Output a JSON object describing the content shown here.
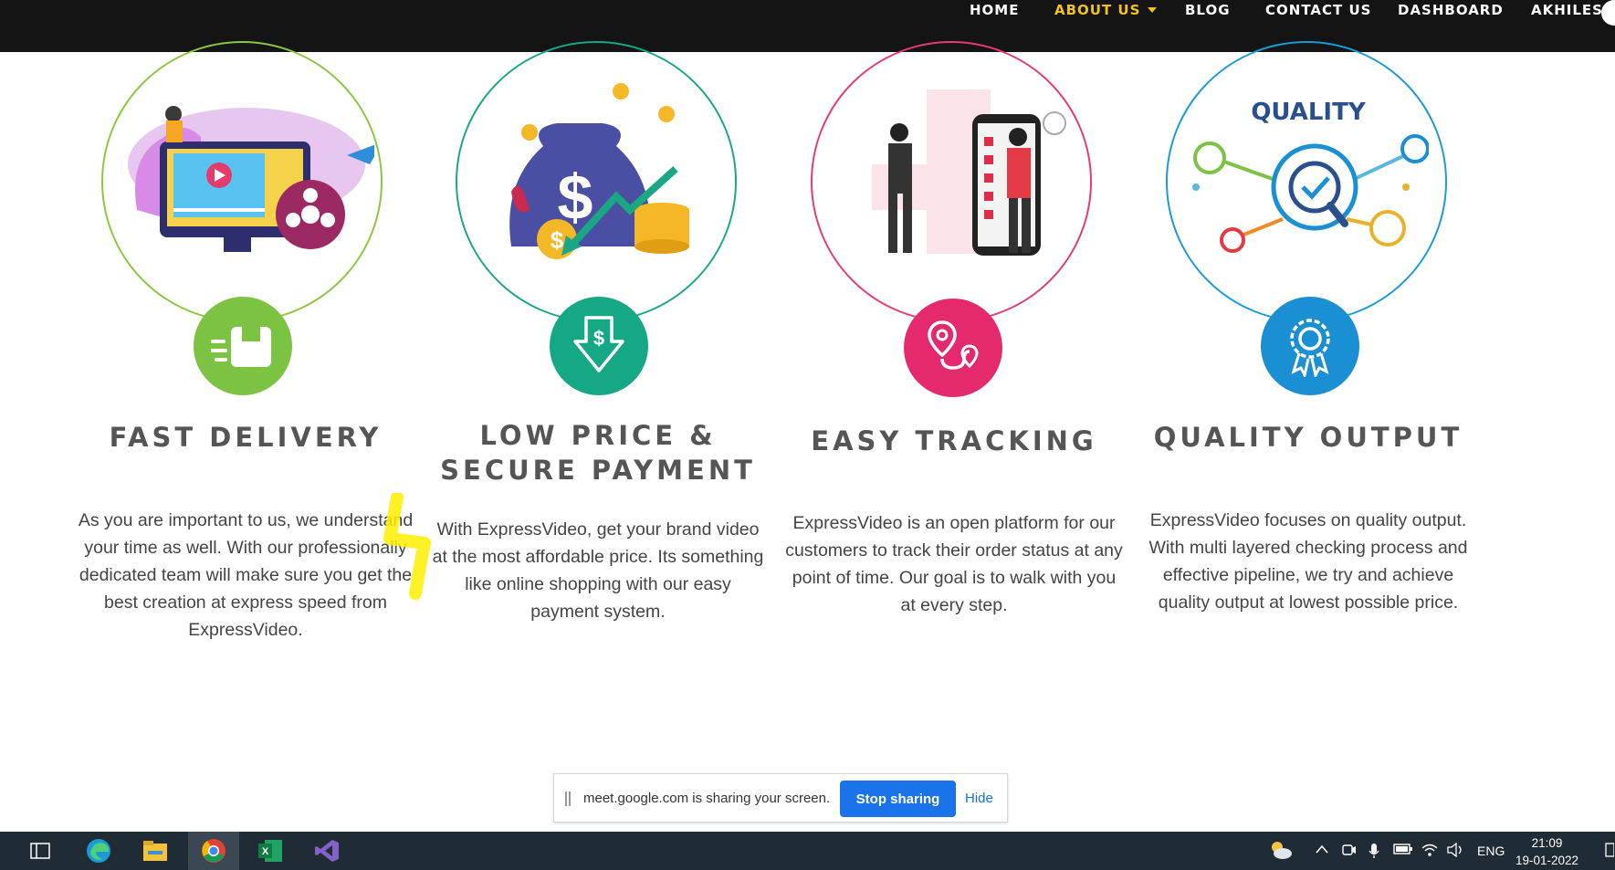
{
  "nav": {
    "items": [
      {
        "label": "HOME"
      },
      {
        "label": "ABOUT US"
      },
      {
        "label": "BLOG"
      },
      {
        "label": "CONTACT US"
      },
      {
        "label": "DASHBOARD"
      },
      {
        "label": "AKHILESH"
      }
    ],
    "active_color": "#f2c318"
  },
  "features": [
    {
      "title": "FAST DELIVERY",
      "description": "As you are important to us, we understand your time as well. With our professionally dedicated team will make sure you get the best creation at express speed from ExpressVideo.",
      "color": "#7cc243",
      "icon": "delivery-box-icon"
    },
    {
      "title": "LOW PRICE & SECURE PAYMENT",
      "description": "With ExpressVideo, get your brand video at the most affordable price. Its something like online shopping with our easy payment system.",
      "color": "#16a884",
      "icon": "price-down-icon"
    },
    {
      "title": "EASY TRACKING",
      "description": "ExpressVideo is an open platform for our customers to track their order status at any point of time. Our goal is to walk with you at every step.",
      "color": "#e42a6d",
      "icon": "route-tracking-icon"
    },
    {
      "title": "QUALITY OUTPUT",
      "description": "ExpressVideo focuses on quality output. With multi layered checking process and effective pipeline, we try and achieve quality output at lowest possible price.",
      "color": "#1a8fd4",
      "icon": "quality-award-icon",
      "illustration_text": "QUALITY"
    }
  ],
  "share_bar": {
    "message": "meet.google.com is sharing your screen.",
    "stop_label": "Stop sharing",
    "hide_label": "Hide"
  },
  "taskbar": {
    "apps": [
      "task-view-icon",
      "edge-icon",
      "file-explorer-icon",
      "chrome-icon",
      "excel-icon",
      "visual-studio-icon"
    ],
    "language": "ENG",
    "time": "21:09",
    "date": "19-01-2022"
  }
}
